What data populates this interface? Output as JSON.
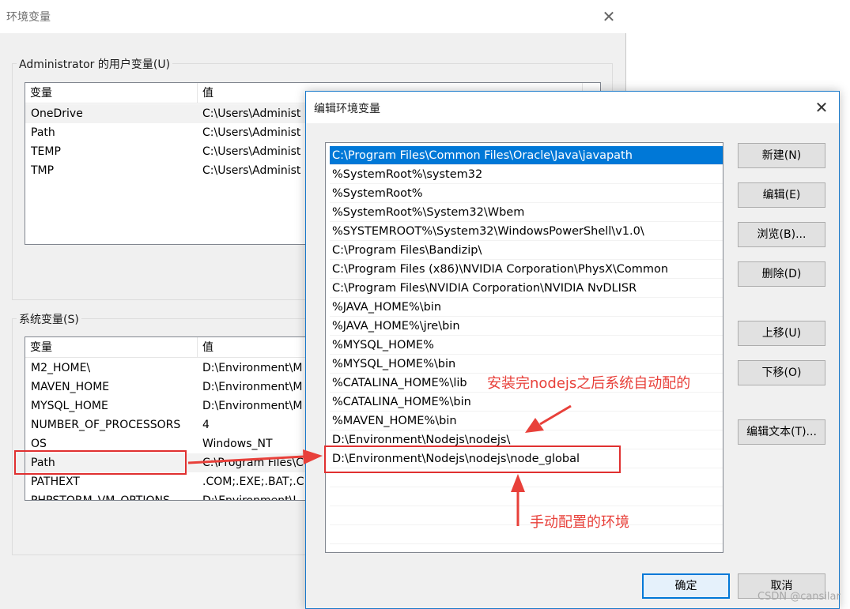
{
  "env_dialog": {
    "title": "环境变量",
    "user_group_title": "Administrator 的用户变量(U)",
    "system_group_title": "系统变量(S)",
    "col_variable": "变量",
    "col_value": "值",
    "user_vars": [
      {
        "name": "OneDrive",
        "value": "C:\\Users\\Administ"
      },
      {
        "name": "Path",
        "value": "C:\\Users\\Administ"
      },
      {
        "name": "TEMP",
        "value": "C:\\Users\\Administ"
      },
      {
        "name": "TMP",
        "value": "C:\\Users\\Administ"
      }
    ],
    "system_vars": [
      {
        "name": "M2_HOME\\",
        "value": "D:\\Environment\\M"
      },
      {
        "name": "MAVEN_HOME",
        "value": "D:\\Environment\\M"
      },
      {
        "name": "MYSQL_HOME",
        "value": "D:\\Environment\\M"
      },
      {
        "name": "NUMBER_OF_PROCESSORS",
        "value": "4"
      },
      {
        "name": "OS",
        "value": "Windows_NT"
      },
      {
        "name": "Path",
        "value": "C:\\Program Files\\C"
      },
      {
        "name": "PATHEXT",
        "value": ".COM;.EXE;.BAT;.C"
      },
      {
        "name": "PHPSTORM_VM_OPTIONS",
        "value": "D:\\Environment\\J"
      }
    ]
  },
  "edit_dialog": {
    "title": "编辑环境变量",
    "paths": [
      "C:\\Program Files\\Common Files\\Oracle\\Java\\javapath",
      "%SystemRoot%\\system32",
      "%SystemRoot%",
      "%SystemRoot%\\System32\\Wbem",
      "%SYSTEMROOT%\\System32\\WindowsPowerShell\\v1.0\\",
      "C:\\Program Files\\Bandizip\\",
      "C:\\Program Files (x86)\\NVIDIA Corporation\\PhysX\\Common",
      "C:\\Program Files\\NVIDIA Corporation\\NVIDIA NvDLISR",
      "%JAVA_HOME%\\bin",
      "%JAVA_HOME%\\jre\\bin",
      "%MYSQL_HOME%",
      "%MYSQL_HOME%\\bin",
      "%CATALINA_HOME%\\lib",
      "%CATALINA_HOME%\\bin",
      "%MAVEN_HOME%\\bin",
      "D:\\Environment\\Nodejs\\nodejs\\",
      "D:\\Environment\\Nodejs\\nodejs\\node_global"
    ],
    "buttons": {
      "new": "新建(N)",
      "edit": "编辑(E)",
      "browse": "浏览(B)...",
      "delete": "删除(D)",
      "move_up": "上移(U)",
      "move_down": "下移(O)",
      "edit_text": "编辑文本(T)...",
      "ok": "确定",
      "cancel": "取消"
    }
  },
  "annotations": {
    "auto_note": "安装完nodejs之后系统自动配的",
    "manual_note": "手动配置的环境",
    "color": "#e8403a"
  },
  "watermark": "CSDN @cansilar"
}
